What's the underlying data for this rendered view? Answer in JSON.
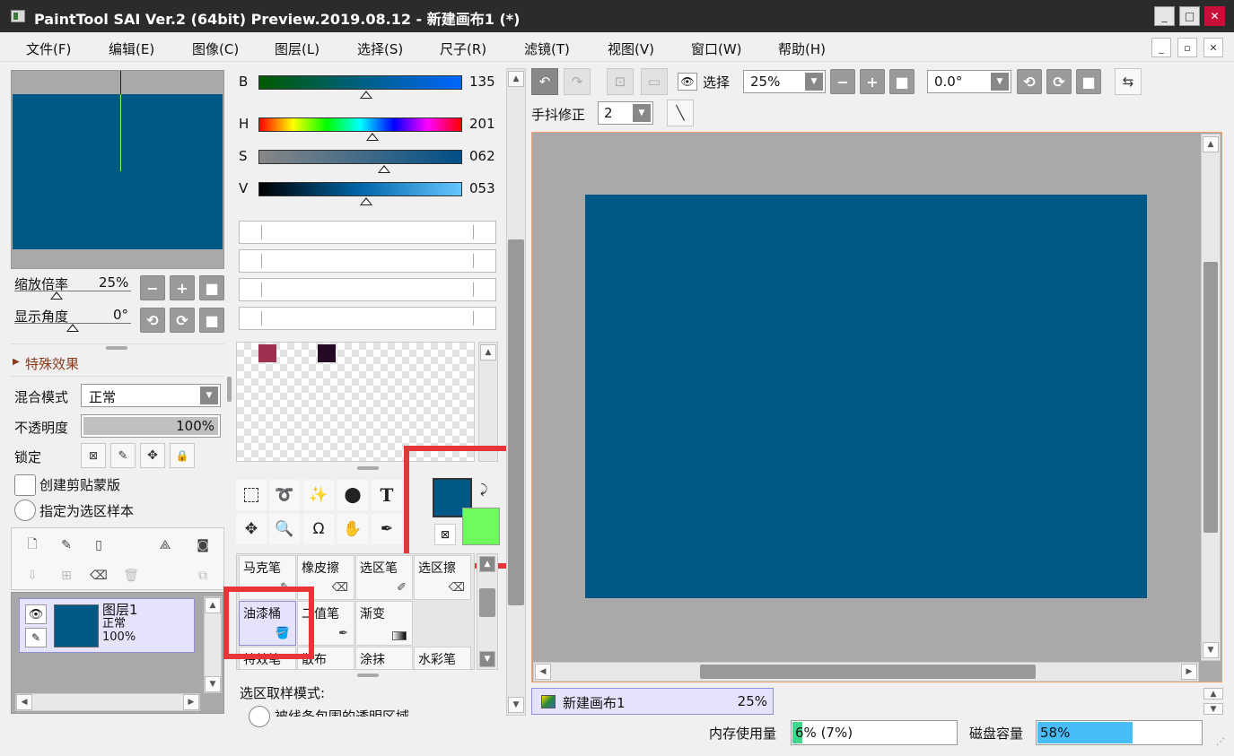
{
  "app": {
    "title": "PaintTool SAI Ver.2 (64bit) Preview.2019.08.12 - 新建画布1 (*)"
  },
  "window_buttons": {
    "minimize": "_",
    "maximize": "□",
    "close": "✕",
    "restore": "▫"
  },
  "menu": [
    "文件(F)",
    "编辑(E)",
    "图像(C)",
    "图层(L)",
    "选择(S)",
    "尺子(R)",
    "滤镜(T)",
    "视图(V)",
    "窗口(W)",
    "帮助(H)"
  ],
  "navigator": {
    "zoom_label": "缩放倍率",
    "zoom_value": "25%",
    "angle_label": "显示角度",
    "angle_value": "0°"
  },
  "layer_props": {
    "effects_label": "特殊效果",
    "blend_label": "混合模式",
    "blend_value": "正常",
    "opacity_label": "不透明度",
    "opacity_value": "100%",
    "opacity_fraction": 1.0,
    "lock_label": "锁定",
    "clip_label": "创建剪贴蒙版",
    "sample_label": "指定为选区样本"
  },
  "layers": [
    {
      "name": "图层1",
      "mode": "正常",
      "opacity": "100%"
    }
  ],
  "color": {
    "sliders": [
      {
        "label": "B",
        "value": "135"
      },
      {
        "label": "H",
        "value": "201"
      },
      {
        "label": "S",
        "value": "062"
      },
      {
        "label": "V",
        "value": "053"
      }
    ],
    "primary": "#005887",
    "secondary": "#6efc5d",
    "swatches": [
      "#a0304f",
      "#240b24"
    ]
  },
  "tools": {
    "text_tool_glyph": "T"
  },
  "brushes": [
    {
      "name": "马克笔"
    },
    {
      "name": "橡皮擦"
    },
    {
      "name": "选区笔"
    },
    {
      "name": "选区擦"
    },
    {
      "name": "油漆桶"
    },
    {
      "name": "二值笔"
    },
    {
      "name": "渐变"
    },
    {
      "name": ""
    },
    {
      "name": "特效笔"
    },
    {
      "name": "散布"
    },
    {
      "name": "涂抹"
    },
    {
      "name": "水彩笔"
    }
  ],
  "tool_options": {
    "sample_mode_label": "选区取样模式:",
    "option1": "被线条包围的透明区域"
  },
  "toolbar": {
    "select_label": "选择",
    "zoom_value": "25%",
    "rotation_value": "0.0°",
    "stabilizer_label": "手抖修正",
    "stabilizer_value": "2"
  },
  "canvas": {
    "color": "#005887",
    "tab_name": "新建画布1",
    "tab_zoom": "25%"
  },
  "status": {
    "memory_label": "内存使用量",
    "memory_value": "6% (7%)",
    "memory_fraction": 0.06,
    "disk_label": "磁盘容量",
    "disk_value": "58%",
    "disk_fraction": 0.58
  }
}
